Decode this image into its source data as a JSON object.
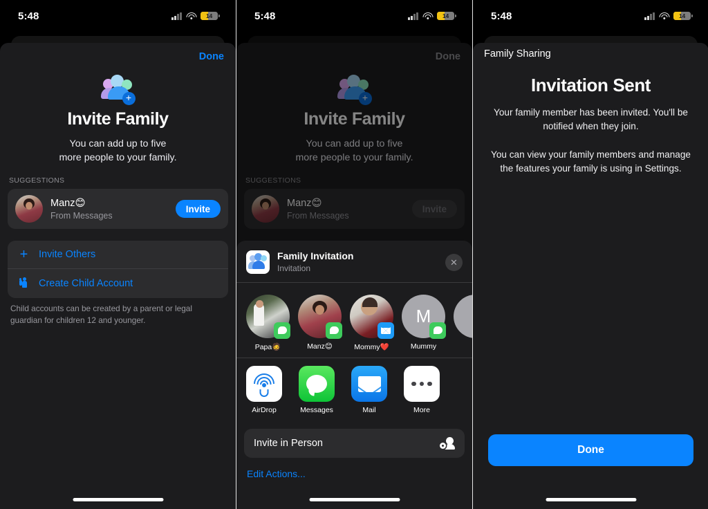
{
  "status_bar": {
    "time": "5:48",
    "battery_percent": "14",
    "battery_color": "#f2c212",
    "wifi_icon": "wifi-icon",
    "cellular_icon": "cellular-signal-icon"
  },
  "accent_color": "#0a84ff",
  "panel1": {
    "done_label": "Done",
    "title": "Invite Family",
    "subtitle_line1": "You can add up to five",
    "subtitle_line2": "more people to your family.",
    "section_label": "SUGGESTIONS",
    "suggestion": {
      "name": "Manz😊",
      "source": "From Messages",
      "button": "Invite"
    },
    "actions": [
      {
        "label": "Invite Others",
        "icon": "plus-icon"
      },
      {
        "label": "Create Child Account",
        "icon": "child-icon"
      }
    ],
    "footnote": "Child accounts can be created by a parent or legal guardian for children 12 and younger."
  },
  "panel2": {
    "done_label": "Done",
    "title": "Invite Family",
    "subtitle_line1": "You can add up to five",
    "subtitle_line2": "more people to your family.",
    "section_label": "SUGGESTIONS",
    "suggestion": {
      "name": "Manz😊",
      "source": "From Messages",
      "button": "Invite"
    },
    "share_sheet": {
      "doc_title": "Family Invitation",
      "doc_subtitle": "Invitation",
      "close_label": "✕",
      "contacts": [
        {
          "name": "Papa🧔",
          "badge": "messages-badge"
        },
        {
          "name": "Manz😊",
          "badge": "messages-badge"
        },
        {
          "name": "Mommy❤️",
          "badge": "mail-badge"
        },
        {
          "name": "Mummy",
          "badge": "messages-badge",
          "initial": "M"
        },
        {
          "name": "",
          "badge": "none",
          "initial": ""
        }
      ],
      "apps": [
        {
          "name": "AirDrop",
          "icon": "airdrop-icon"
        },
        {
          "name": "Messages",
          "icon": "messages-icon"
        },
        {
          "name": "Mail",
          "icon": "mail-icon"
        },
        {
          "name": "More",
          "icon": "more-icon"
        }
      ],
      "invite_in_person": {
        "label": "Invite in Person",
        "icon": "share-person-icon"
      },
      "edit_actions": "Edit Actions..."
    }
  },
  "panel3": {
    "nav_title": "Family Sharing",
    "title": "Invitation Sent",
    "paragraph1": "Your family member has been invited. You'll be notified when they join.",
    "paragraph2": "You can view your family members and manage the features your family is using in Settings.",
    "done_button": "Done"
  }
}
